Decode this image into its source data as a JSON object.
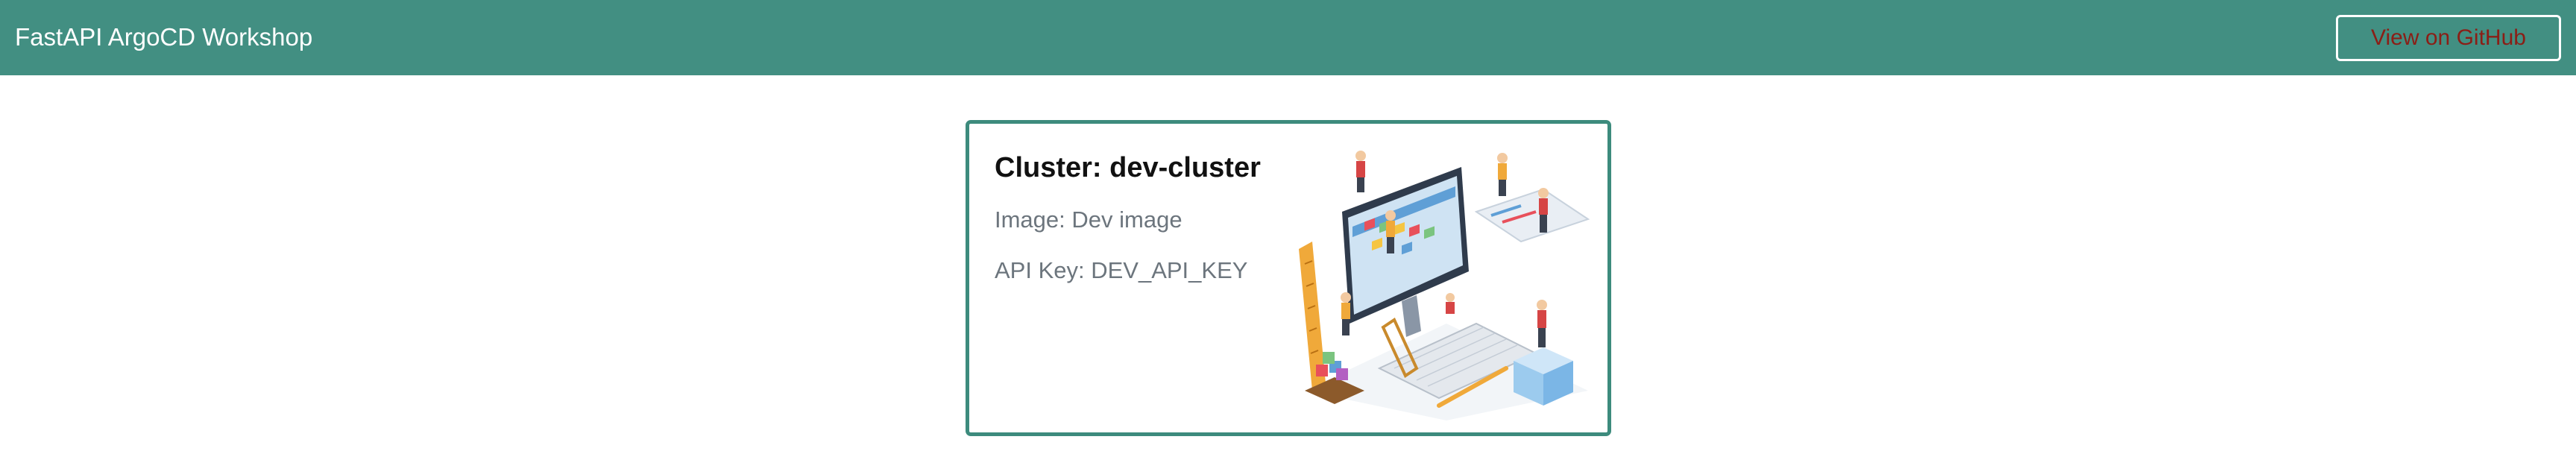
{
  "navbar": {
    "brand": "FastAPI ArgoCD Workshop",
    "github_button": "View on GitHub"
  },
  "card": {
    "title": "Cluster: dev-cluster",
    "image_line": "Image: Dev image",
    "api_key_line": "API Key: DEV_API_KEY",
    "illustration_alt": "isometric-team-building-dashboard-illustration"
  },
  "colors": {
    "navbar_bg": "#428f82",
    "card_border": "#3d8b7d",
    "button_text": "#8b1e16"
  }
}
